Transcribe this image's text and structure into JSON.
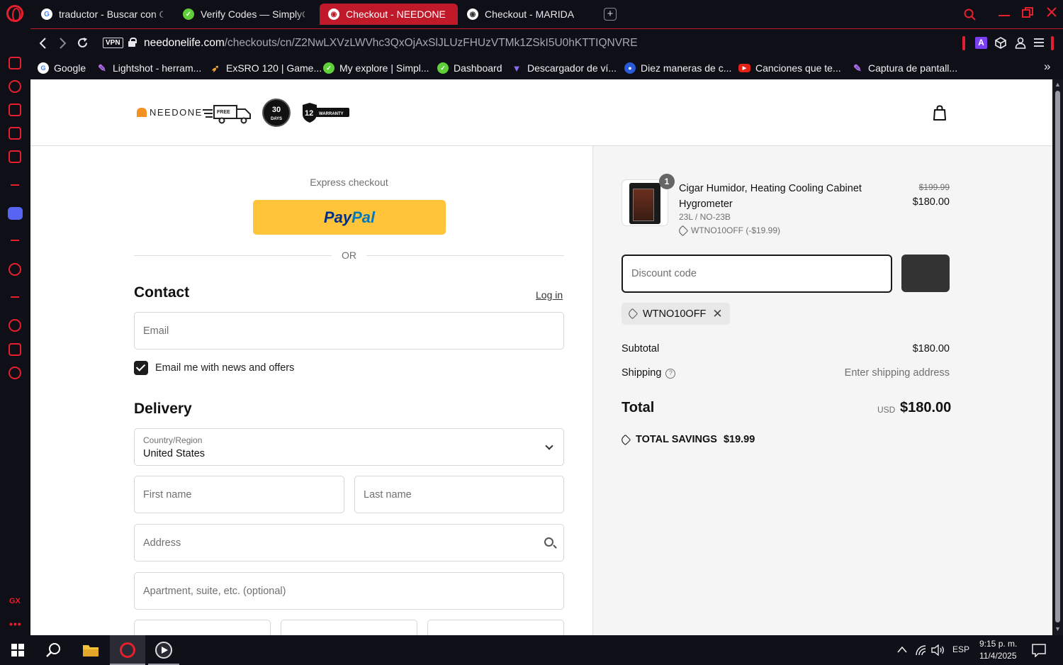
{
  "browser": {
    "tabs": [
      {
        "title": "traductor - Buscar con Go",
        "icon": "google-icon",
        "active": false
      },
      {
        "title": "Verify Codes — SimplyCo",
        "icon": "simplycodes-icon",
        "active": false
      },
      {
        "title": "Checkout - NEEDONE",
        "icon": "shop-icon",
        "active": true
      },
      {
        "title": "Checkout - MARIDA",
        "icon": "shop-icon",
        "active": false
      }
    ],
    "new_tab": "+",
    "vpn_label": "VPN",
    "url_host": "needonelife.com",
    "url_path": "/checkouts/cn/Z2NwLXVzLWVhc3QxOjAxSlJLUzFHUzVTMk1ZSkI5U0hKTTIQNVRE",
    "extension_label": "A",
    "bookmarks": [
      {
        "label": "Google",
        "icon": "google-icon"
      },
      {
        "label": "Lightshot - herram...",
        "icon": "feather-icon"
      },
      {
        "label": "ExSRO 120 | Game...",
        "icon": "game-icon"
      },
      {
        "label": "My explore | Simpl...",
        "icon": "simplycodes-icon"
      },
      {
        "label": "Dashboard",
        "icon": "simplycodes-icon"
      },
      {
        "label": "Descargador de ví...",
        "icon": "download-icon"
      },
      {
        "label": "Diez maneras de c...",
        "icon": "globe-icon"
      },
      {
        "label": "Canciones que te...",
        "icon": "youtube-icon"
      },
      {
        "label": "Captura de pantall...",
        "icon": "feather-icon"
      }
    ],
    "sidebar_gx": "GX",
    "sidebar_more": "•••"
  },
  "shop": {
    "logo_text": "NEEDONE",
    "badge_days": "30",
    "badge_days_sub": "DAYS",
    "badge_warranty_num": "12",
    "badge_warranty_text": "WARRANTY",
    "truck_text": "FREE"
  },
  "checkout": {
    "express_label": "Express checkout",
    "paypal_a": "Pay",
    "paypal_b": "Pal",
    "or_label": "OR",
    "contact_title": "Contact",
    "login_link": "Log in",
    "email_placeholder": "Email",
    "newsletter_label": "Email me with news and offers",
    "newsletter_checked": true,
    "delivery_title": "Delivery",
    "country_label": "Country/Region",
    "country_value": "United States",
    "first_name_placeholder": "First name",
    "last_name_placeholder": "Last name",
    "address_placeholder": "Address",
    "apartment_placeholder": "Apartment, suite, etc. (optional)"
  },
  "summary": {
    "product_name": "Cigar Humidor, Heating Cooling Cabinet Hygrometer",
    "product_variant": "23L / NO-23B",
    "product_discount": "WTNO10OFF (-$19.99)",
    "quantity": "1",
    "price_original": "$199.99",
    "price_final": "$180.00",
    "discount_placeholder": "Discount code",
    "applied_code": "WTNO10OFF",
    "subtotal_label": "Subtotal",
    "subtotal_value": "$180.00",
    "shipping_label": "Shipping",
    "shipping_value": "Enter shipping address",
    "total_label": "Total",
    "total_currency": "USD",
    "total_value": "$180.00",
    "savings_label": "TOTAL SAVINGS",
    "savings_value": "$19.99"
  },
  "taskbar": {
    "language": "ESP",
    "time": "9:15 p. m.",
    "date": "11/4/2025"
  },
  "colors": {
    "accent": "#e5202e",
    "paypal_yellow": "#ffc439",
    "summary_bg": "#f5f5f5"
  }
}
